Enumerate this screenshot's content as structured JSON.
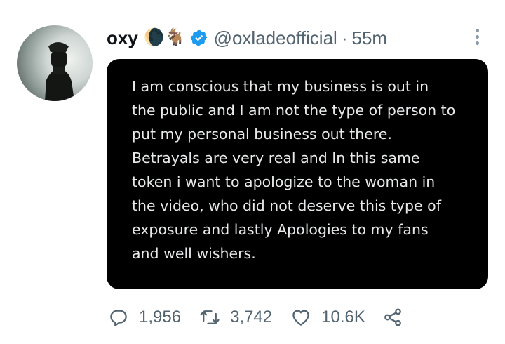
{
  "tweet": {
    "author": {
      "name": "oxy",
      "emojis": "🌘🐐",
      "handle": "@oxladeofficial",
      "separator": "·",
      "timestamp": "55m"
    },
    "image_text_lines": [
      "I am conscious that my business is out in",
      "the public and I am not the type of person to",
      "put my personal business out there.",
      "Betrayals are very real and In this same",
      "token i want to apologize to the woman in",
      "the video, who did not deserve this type of",
      "exposure and lastly Apologies to my fans",
      "and well wishers."
    ],
    "actions": {
      "reply_count": "1,956",
      "retweet_count": "3,742",
      "like_count": "10.6K"
    }
  },
  "colors": {
    "verified": "#1d9bf0",
    "muted": "#536471",
    "card_bg": "#000000",
    "card_text": "#e7e9ea"
  },
  "icons": [
    "verified-badge-icon",
    "more-options-icon",
    "reply-icon",
    "retweet-icon",
    "like-icon",
    "share-icon"
  ]
}
